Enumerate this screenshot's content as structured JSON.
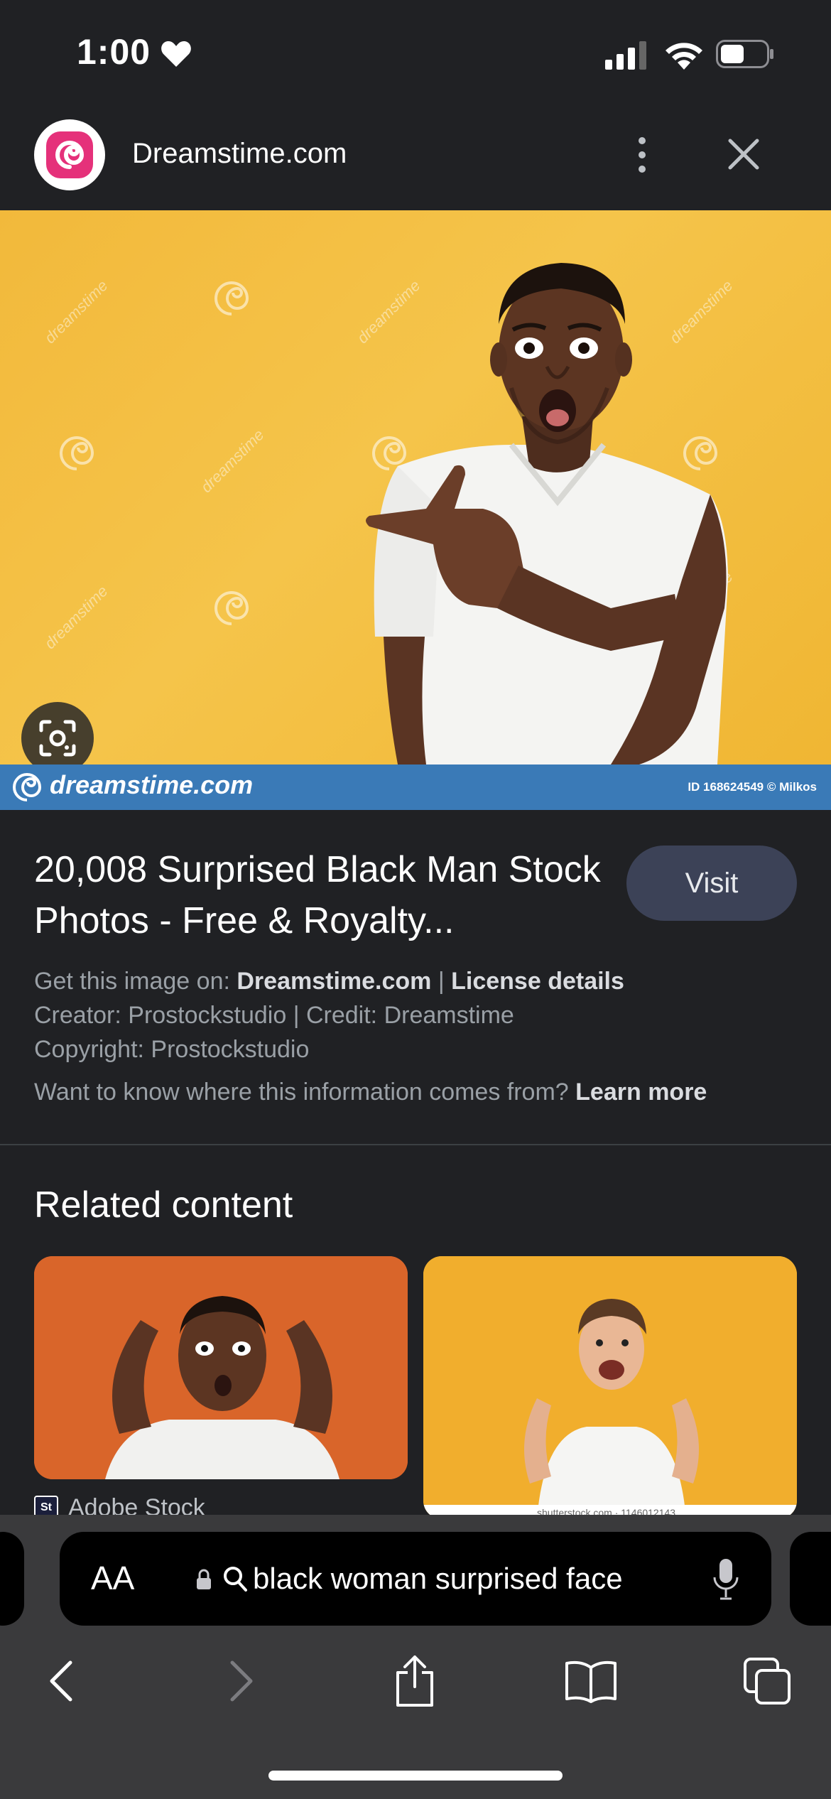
{
  "status_bar": {
    "time": "1:00",
    "icons": [
      "heart-icon",
      "cellular-signal-icon",
      "wifi-icon",
      "battery-icon"
    ]
  },
  "site_header": {
    "site_name": "Dreamstime.com",
    "icons": [
      "dreamstime-logo",
      "more-vert-icon",
      "close-icon"
    ]
  },
  "image": {
    "watermark_brand": "dreamstime.com",
    "watermark_id": "ID 168624549 © Milkos",
    "watermark_tile": "dreamstime",
    "lens_icon": "google-lens-icon"
  },
  "result": {
    "title": "20,008 Surprised Black Man Stock Photos - Free & Royalty...",
    "visit_label": "Visit",
    "get_image_prefix": "Get this image on: ",
    "get_image_site": "Dreamstime.com",
    "separator": " | ",
    "license_link": "License details",
    "creator_line": "Creator: Prostockstudio | Credit: Dreamstime",
    "copyright_line": "Copyright: Prostockstudio",
    "info_question": "Want to know where this information comes from? ",
    "learn_more": "Learn more"
  },
  "related": {
    "heading": "Related content",
    "items": [
      {
        "source": "Adobe Stock",
        "source_icon_text": "St"
      },
      {
        "source": "shutterstock.com · 1146012143"
      }
    ]
  },
  "browser": {
    "text_size_label": "AA",
    "address_text": "black woman surprised face",
    "icons": [
      "lock-icon",
      "search-icon",
      "microphone-icon",
      "back-icon",
      "forward-icon",
      "share-icon",
      "bookmarks-icon",
      "tabs-icon"
    ]
  },
  "colors": {
    "background": "#202124",
    "visit_button": "#3c4257",
    "hero_yellow": "#f5c44a",
    "band_blue": "#3a7ab7",
    "toolbar": "#3a3a3c",
    "dreamstime_pink": "#e5317a"
  }
}
